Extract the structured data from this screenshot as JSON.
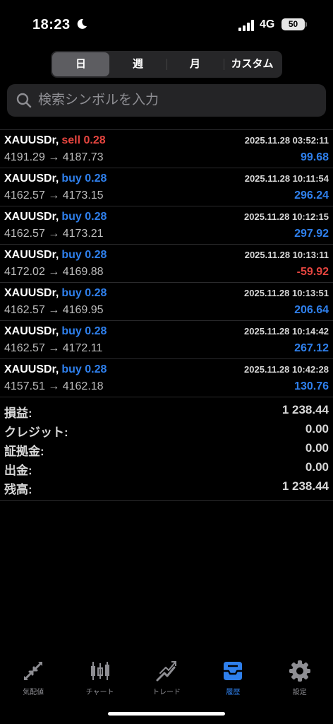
{
  "status": {
    "time": "18:23",
    "network": "4G",
    "battery": "50"
  },
  "segments": [
    "日",
    "週",
    "月",
    "カスタム"
  ],
  "search": {
    "placeholder": "検索シンボルを入力"
  },
  "trades": [
    {
      "symbol": "XAUUSDr,",
      "side": "sell",
      "lots": "0.28",
      "open": "4191.29",
      "close": "4187.73",
      "date": "2025.11.28 03:52:11",
      "profit": "99.68"
    },
    {
      "symbol": "XAUUSDr,",
      "side": "buy",
      "lots": "0.28",
      "open": "4162.57",
      "close": "4173.15",
      "date": "2025.11.28 10:11:54",
      "profit": "296.24"
    },
    {
      "symbol": "XAUUSDr,",
      "side": "buy",
      "lots": "0.28",
      "open": "4162.57",
      "close": "4173.21",
      "date": "2025.11.28 10:12:15",
      "profit": "297.92"
    },
    {
      "symbol": "XAUUSDr,",
      "side": "buy",
      "lots": "0.28",
      "open": "4172.02",
      "close": "4169.88",
      "date": "2025.11.28 10:13:11",
      "profit": "-59.92"
    },
    {
      "symbol": "XAUUSDr,",
      "side": "buy",
      "lots": "0.28",
      "open": "4162.57",
      "close": "4169.95",
      "date": "2025.11.28 10:13:51",
      "profit": "206.64"
    },
    {
      "symbol": "XAUUSDr,",
      "side": "buy",
      "lots": "0.28",
      "open": "4162.57",
      "close": "4172.11",
      "date": "2025.11.28 10:14:42",
      "profit": "267.12"
    },
    {
      "symbol": "XAUUSDr,",
      "side": "buy",
      "lots": "0.28",
      "open": "4157.51",
      "close": "4162.18",
      "date": "2025.11.28 10:42:28",
      "profit": "130.76"
    }
  ],
  "summary": [
    {
      "label": "損益:",
      "value": "1 238.44"
    },
    {
      "label": "クレジット:",
      "value": "0.00"
    },
    {
      "label": "証拠金:",
      "value": "0.00"
    },
    {
      "label": "出金:",
      "value": "0.00"
    },
    {
      "label": "残高:",
      "value": "1 238.44"
    }
  ],
  "tabs": [
    {
      "label": "気配値",
      "icon": "quotes-icon"
    },
    {
      "label": "チャート",
      "icon": "chart-icon"
    },
    {
      "label": "トレード",
      "icon": "trade-icon"
    },
    {
      "label": "履歴",
      "icon": "history-icon",
      "active": true
    },
    {
      "label": "設定",
      "icon": "settings-icon"
    }
  ],
  "colors": {
    "buy": "#2f80ed",
    "sell": "#e5453f",
    "active_tab": "#2f80ed"
  }
}
